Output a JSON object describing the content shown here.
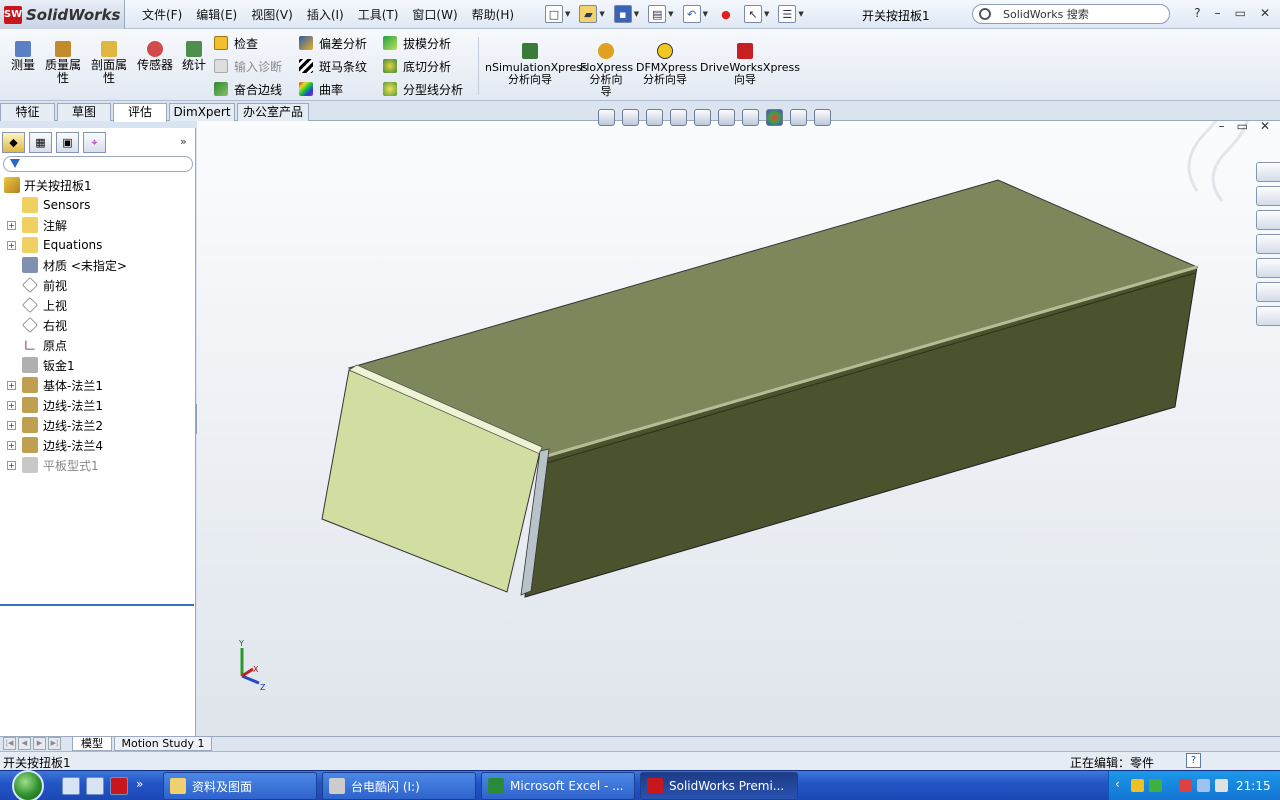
{
  "app": {
    "logo_text": "SolidWorks",
    "doc_title": "开关按扭板1"
  },
  "menu": [
    "文件(F)",
    "编辑(E)",
    "视图(V)",
    "插入(I)",
    "工具(T)",
    "窗口(W)",
    "帮助(H)"
  ],
  "search": {
    "placeholder": "SolidWorks 搜索"
  },
  "window_controls": [
    "?",
    "–",
    "▭",
    "✕"
  ],
  "commands": {
    "measure": "测量",
    "mass_props": "质量属\n性",
    "section_props": "剖面属\n性",
    "sensor": "传感器",
    "statistics": "统计",
    "check": "检查",
    "import_diag": "输入诊断",
    "deviation": "偏差分析",
    "zebra": "斑马条纹",
    "curvature": "曲率",
    "draft": "拔模分析",
    "undercut": "底切分析",
    "parting": "分型线分析",
    "fillet_edges": "奋合边线",
    "simulation": "nSimulationXpress\n分析向导",
    "floxpress": "FloXpress\n分析向\n导",
    "dfmxpress": "DFMXpress\n分析向导",
    "driveworks": "DriveWorksXpress\n向导"
  },
  "tabs": [
    "特征",
    "草图",
    "评估",
    "DimXpert",
    "办公室产品"
  ],
  "active_tab": "评估",
  "tree": {
    "root": "开关按扭板1",
    "items": [
      {
        "label": "Sensors",
        "expand": false,
        "icon": "sensor-icon"
      },
      {
        "label": "注解",
        "expand": true,
        "icon": "annotation-icon"
      },
      {
        "label": "Equations",
        "expand": true,
        "icon": "equation-icon"
      },
      {
        "label": "材质 <未指定>",
        "expand": false,
        "icon": "material-icon"
      },
      {
        "label": "前视",
        "expand": false,
        "icon": "plane-icon"
      },
      {
        "label": "上视",
        "expand": false,
        "icon": "plane-icon"
      },
      {
        "label": "右视",
        "expand": false,
        "icon": "plane-icon"
      },
      {
        "label": "原点",
        "expand": false,
        "icon": "origin-icon"
      },
      {
        "label": "钣金1",
        "expand": false,
        "icon": "sheetmetal-icon"
      },
      {
        "label": "基体-法兰1",
        "expand": true,
        "icon": "base-flange-icon"
      },
      {
        "label": "边线-法兰1",
        "expand": true,
        "icon": "edge-flange-icon"
      },
      {
        "label": "边线-法兰2",
        "expand": true,
        "icon": "edge-flange-icon"
      },
      {
        "label": "边线-法兰4",
        "expand": true,
        "icon": "edge-flange-icon"
      },
      {
        "label": "平板型式1",
        "expand": true,
        "icon": "flat-pattern-icon",
        "disabled": true
      }
    ]
  },
  "bottom_tabs": [
    "模型",
    "Motion Study 1"
  ],
  "status": {
    "left": "开关按扭板1",
    "right": "正在编辑：零件",
    "help": "?"
  },
  "axes": {
    "x": "X",
    "y": "Y",
    "z": "Z"
  },
  "taskbar": {
    "quicklaunch_more": "»",
    "tasks": [
      "资料及图面",
      "台电酷闪 (I:)",
      "Microsoft Excel - ...",
      "SolidWorks Premi..."
    ],
    "clock": "21:15"
  }
}
